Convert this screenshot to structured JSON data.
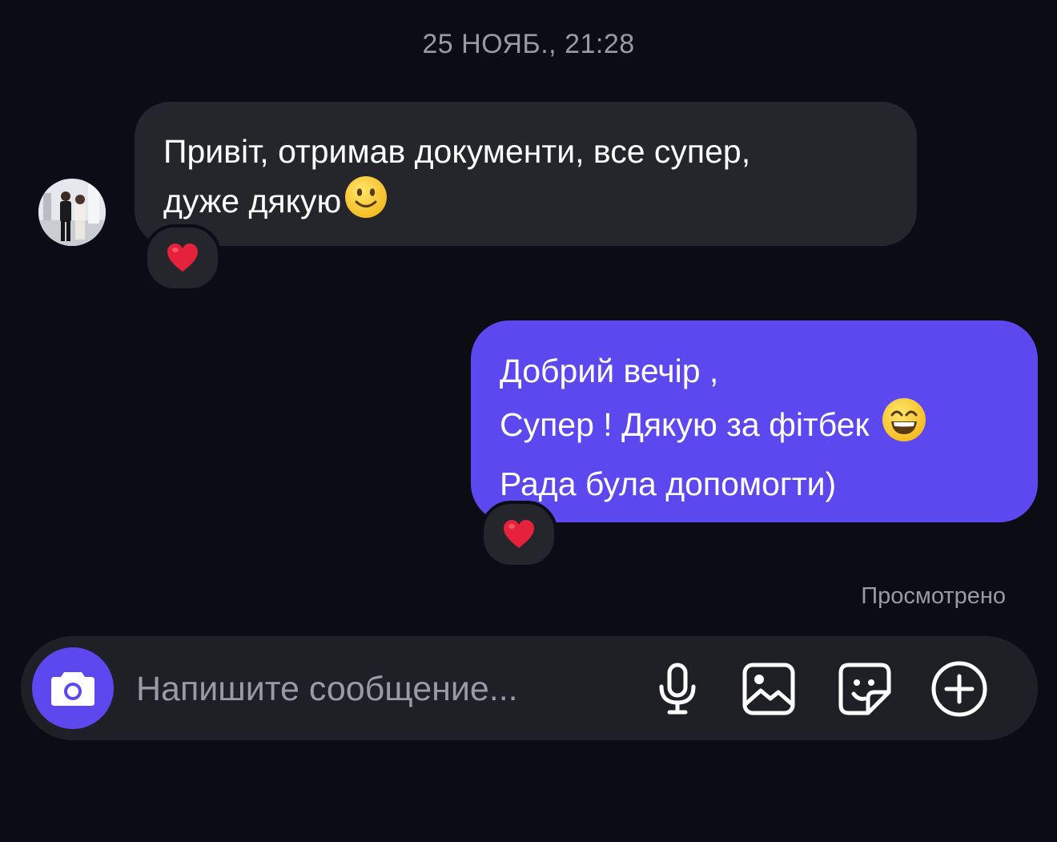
{
  "conversation": {
    "timestamp": "25 НОЯБ., 21:28",
    "messages": [
      {
        "direction": "incoming",
        "lines": [
          "Привіт, отримав документи, все супер,",
          "дуже дякую"
        ],
        "emoji": "slightly-smiling-face",
        "reaction": "❤️"
      },
      {
        "direction": "outgoing",
        "lines": [
          "Добрий вечір ,",
          "Супер ! Дякую за фітбек",
          "Рада була допомогти)"
        ],
        "emoji": "grinning-face-with-smiling-eyes",
        "reaction": "❤️"
      }
    ],
    "seen_status": "Просмотрено"
  },
  "composer": {
    "placeholder": "Напишите сообщение...",
    "icons": [
      "camera-icon",
      "microphone-icon",
      "gallery-icon",
      "sticker-icon",
      "plus-circle-icon"
    ]
  },
  "colors": {
    "background": "#0b0c14",
    "incoming_bubble": "#25262b",
    "outgoing_bubble": "#5b48ee",
    "muted_text": "#9a9ba2",
    "composer_background": "#1f2025"
  }
}
